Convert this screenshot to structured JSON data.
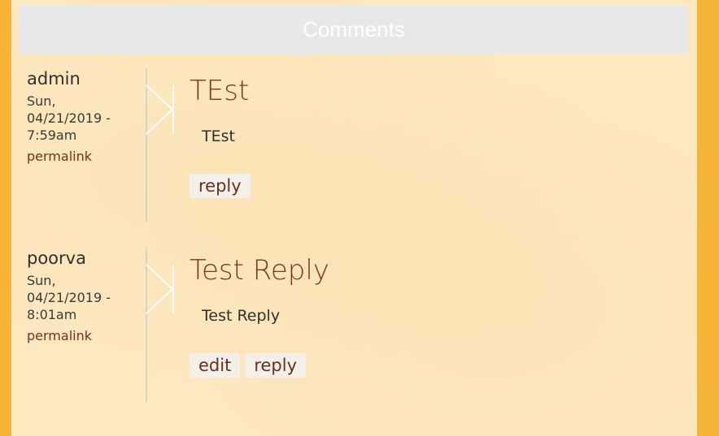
{
  "header": {
    "title": "Comments"
  },
  "comments": [
    {
      "author": "admin",
      "date": "Sun, 04/21/2019 - 7:59am",
      "permalink": "permalink",
      "title": "TEst",
      "text": "TEst",
      "actions": [
        "reply"
      ]
    },
    {
      "author": "poorva",
      "date": "Sun, 04/21/2019 - 8:01am",
      "permalink": "permalink",
      "title": "Test Reply",
      "text": "Test Reply",
      "actions": [
        "edit",
        "reply"
      ]
    }
  ],
  "colors": {
    "page_background": "#f6b536",
    "panel_background": "#fee8c0",
    "header_background": "#e8e8e8",
    "title_color": "#7b3526",
    "link_color": "#7a2f22"
  }
}
